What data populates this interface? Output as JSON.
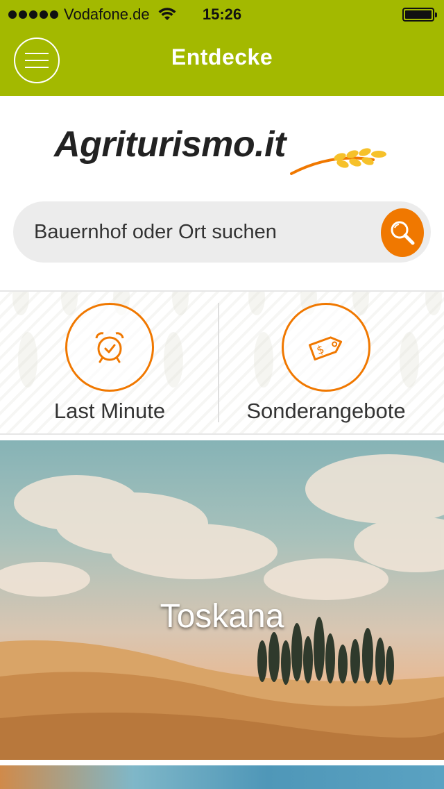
{
  "status_bar": {
    "carrier": "Vodafone.de",
    "time": "15:26",
    "signal_icon": "signal-dots-icon",
    "wifi_icon": "wifi-icon",
    "battery_icon": "battery-icon"
  },
  "nav": {
    "title": "Entdecke",
    "menu_icon": "hamburger-menu-icon"
  },
  "logo": {
    "text": "Agriturismo.it",
    "icon": "wheat-icon"
  },
  "search": {
    "placeholder": "Bauernhof oder Ort suchen",
    "value": "",
    "icon": "search-icon"
  },
  "quick_actions": [
    {
      "label": "Last Minute",
      "icon": "alarm-clock-icon"
    },
    {
      "label": "Sonderangebote",
      "icon": "price-tag-icon"
    }
  ],
  "destinations": [
    {
      "title": "Toskana"
    }
  ],
  "colors": {
    "brand_green": "#a3b900",
    "accent_orange": "#f07800"
  }
}
